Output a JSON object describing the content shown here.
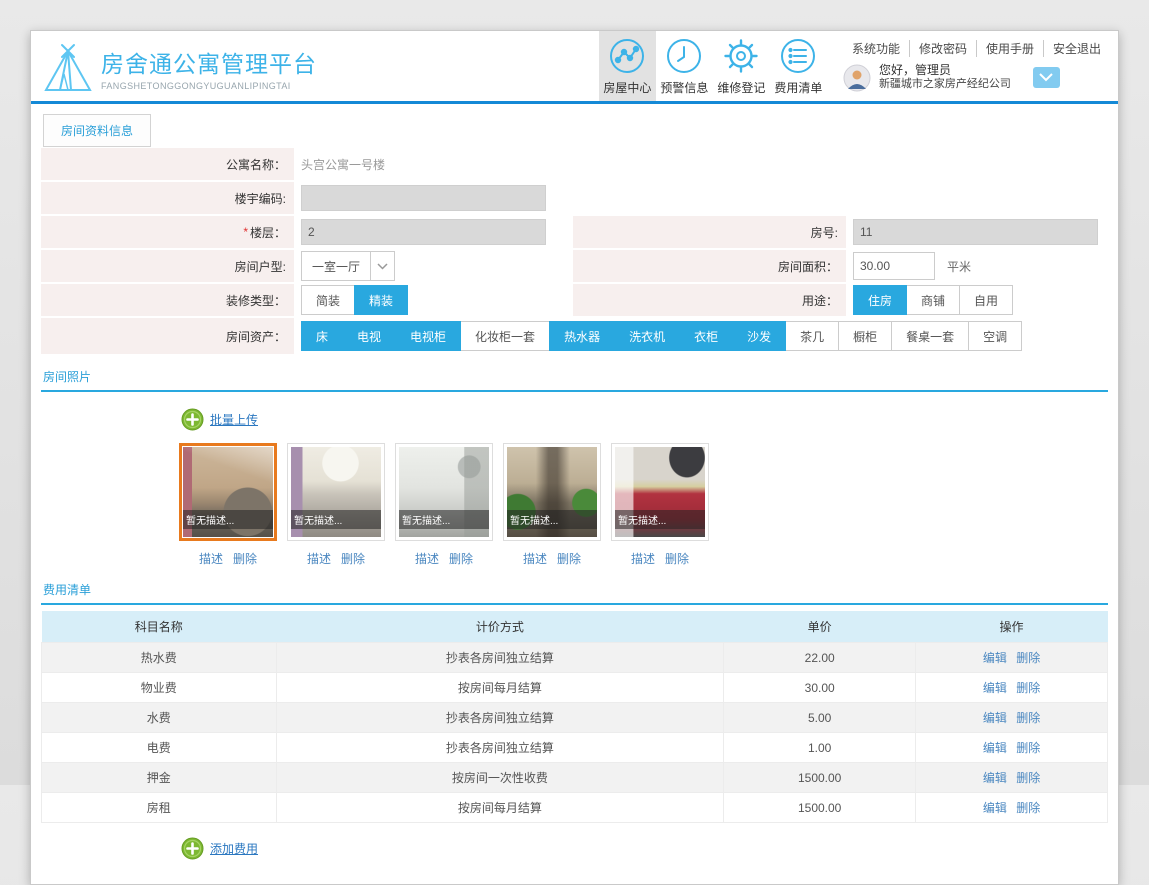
{
  "colors": {
    "accent": "#29a8df",
    "header_border": "#1489d6",
    "label_bg": "#f7efee",
    "table_header_bg": "#d7eef8",
    "selected_photo_border": "#e87a1e",
    "add_icon_green": "#7db832",
    "logo_blue": "#3db3e8"
  },
  "header": {
    "logo": {
      "title": "房舍通公寓管理平台",
      "subtitle": "FANGSHETONGGONGYUGUANLIPINGTAI"
    },
    "nav": [
      {
        "label": "房屋中心",
        "icon": "chart-nodes-icon",
        "active": true
      },
      {
        "label": "预警信息",
        "icon": "clock-icon",
        "active": false
      },
      {
        "label": "维修登记",
        "icon": "gear-icon",
        "active": false
      },
      {
        "label": "费用清单",
        "icon": "list-circle-icon",
        "active": false
      }
    ],
    "links": [
      "系统功能",
      "修改密码",
      "使用手册",
      "安全退出"
    ],
    "user": {
      "greeting": "您好，管理员",
      "company": "新疆城市之家房产经纪公司"
    }
  },
  "tab": {
    "label": "房间资料信息"
  },
  "form": {
    "apartment_name": {
      "label": "公寓名称：",
      "value": "头宫公寓一号楼"
    },
    "building_code": {
      "label": "楼宇编码:",
      "value": ""
    },
    "floor": {
      "required": "*",
      "label": "楼层：",
      "value": "2"
    },
    "room_no": {
      "label": "房号:",
      "value": "11"
    },
    "room_type": {
      "label": "房间户型:",
      "value": "一室一厅"
    },
    "room_area": {
      "label": "房间面积：",
      "value": "30.00",
      "unit": "平米"
    },
    "decoration": {
      "label": "装修类型：",
      "options": [
        {
          "label": "简装",
          "selected": false
        },
        {
          "label": "精装",
          "selected": true
        }
      ]
    },
    "usage": {
      "label": "用途：",
      "options": [
        {
          "label": "住房",
          "selected": true
        },
        {
          "label": "商铺",
          "selected": false
        },
        {
          "label": "自用",
          "selected": false
        }
      ]
    },
    "assets": {
      "label": "房间资产：",
      "options": [
        {
          "label": "床",
          "selected": true
        },
        {
          "label": "电视",
          "selected": true
        },
        {
          "label": "电视柜",
          "selected": true
        },
        {
          "label": "化妆柜一套",
          "selected": false
        },
        {
          "label": "热水器",
          "selected": true
        },
        {
          "label": "洗衣机",
          "selected": true
        },
        {
          "label": "衣柜",
          "selected": true
        },
        {
          "label": "沙发",
          "selected": true
        },
        {
          "label": "茶几",
          "selected": false
        },
        {
          "label": "橱柜",
          "selected": false
        },
        {
          "label": "餐桌一套",
          "selected": false
        },
        {
          "label": "空调",
          "selected": false
        }
      ]
    }
  },
  "photos": {
    "section_title": "房间照片",
    "upload_label": "批量上传",
    "items": [
      {
        "scene": "living-room",
        "caption": "暂无描述...",
        "desc_link": "描述",
        "delete_link": "删除",
        "selected": true
      },
      {
        "scene": "bedroom",
        "caption": "暂无描述...",
        "desc_link": "描述",
        "delete_link": "删除",
        "selected": false
      },
      {
        "scene": "bathroom",
        "caption": "暂无描述...",
        "desc_link": "描述",
        "delete_link": "删除",
        "selected": false
      },
      {
        "scene": "corridor",
        "caption": "暂无描述...",
        "desc_link": "描述",
        "delete_link": "删除",
        "selected": false
      },
      {
        "scene": "kitchen",
        "caption": "暂无描述...",
        "desc_link": "描述",
        "delete_link": "删除",
        "selected": false
      }
    ]
  },
  "fees": {
    "section_title": "费用清单",
    "columns": [
      "科目名称",
      "计价方式",
      "单价",
      "操作"
    ],
    "rows": [
      [
        "热水费",
        "抄表各房间独立结算",
        "22.00"
      ],
      [
        "物业费",
        "按房间每月结算",
        "30.00"
      ],
      [
        "水费",
        "抄表各房间独立结算",
        "5.00"
      ],
      [
        "电费",
        "抄表各房间独立结算",
        "1.00"
      ],
      [
        "押金",
        "按房间一次性收费",
        "1500.00"
      ],
      [
        "房租",
        "按房间每月结算",
        "1500.00"
      ]
    ],
    "edit_label": "编辑",
    "delete_label": "删除",
    "add_label": "添加费用"
  }
}
